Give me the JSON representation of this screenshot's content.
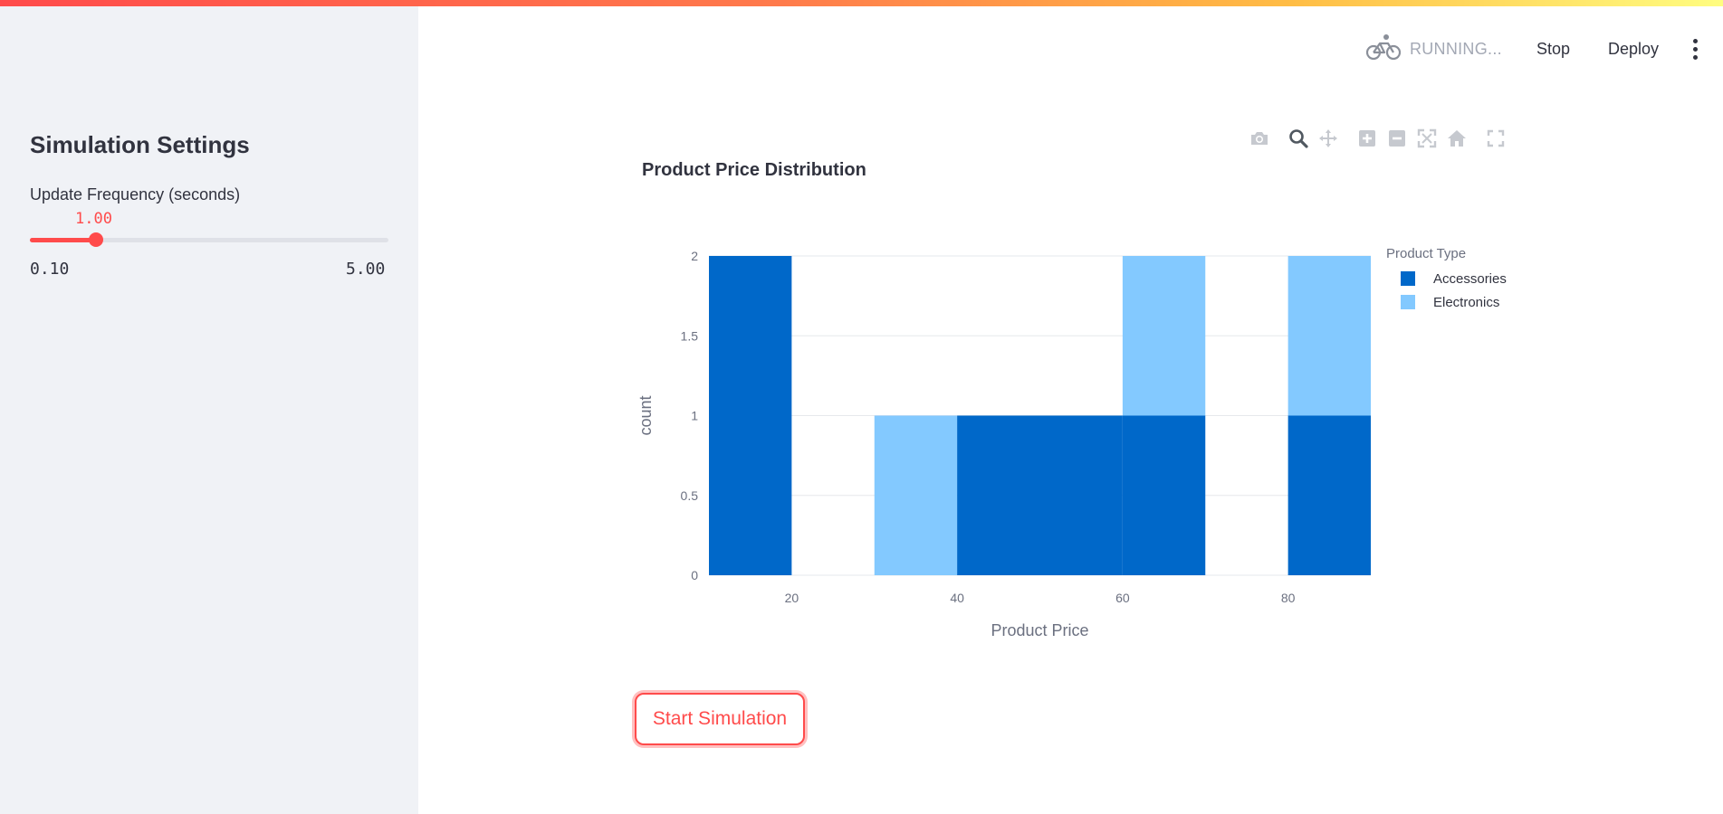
{
  "header": {
    "status_text": "RUNNING...",
    "status_icon": "bicycle-icon",
    "stop_label": "Stop",
    "deploy_label": "Deploy",
    "menu_icon": "more-vertical-icon"
  },
  "sidebar": {
    "title": "Simulation Settings",
    "slider": {
      "label": "Update Frequency (seconds)",
      "value": "1.00",
      "min": "0.10",
      "max": "5.00",
      "value_num": 1.0,
      "min_num": 0.1,
      "max_num": 5.0
    }
  },
  "main": {
    "modebar_icons": [
      "camera-icon",
      "zoom-icon",
      "pan-icon",
      "zoom-in-icon",
      "zoom-out-icon",
      "autoscale-icon",
      "reset-axes-icon",
      "fullscreen-icon"
    ],
    "start_button_label": "Start Simulation"
  },
  "colors": {
    "accent": "#ff4b4b",
    "accessories": "#0068c9",
    "electronics": "#83c9ff"
  },
  "chart_data": {
    "type": "bar",
    "title": "Product Price Distribution",
    "xlabel": "Product Price",
    "ylabel": "count",
    "legend_title": "Product Type",
    "legend_position": "top-right",
    "stacked": true,
    "bin_width": 10,
    "bins": [
      10,
      20,
      30,
      40,
      50,
      60,
      70,
      80
    ],
    "series": [
      {
        "name": "Accessories",
        "values": [
          2,
          0,
          0,
          1,
          1,
          1,
          0,
          1
        ]
      },
      {
        "name": "Electronics",
        "values": [
          0,
          0,
          1,
          0,
          0,
          1,
          0,
          1
        ]
      }
    ],
    "xlim": [
      10,
      90
    ],
    "ylim": [
      0,
      2
    ],
    "xticks": [
      "20",
      "40",
      "60",
      "80"
    ],
    "yticks": [
      "0",
      "0.5",
      "1",
      "1.5",
      "2"
    ],
    "grid": true
  }
}
